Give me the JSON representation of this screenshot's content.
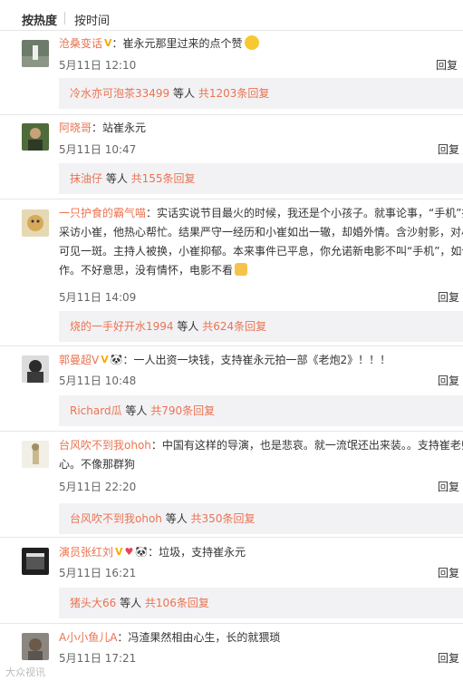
{
  "tabs": {
    "hot": "按热度",
    "time": "按时间"
  },
  "comments": [
    {
      "user": "沧桑变话",
      "badges": [
        "V"
      ],
      "text": "：崔永元那里过来的点个赞",
      "emoji": "grin-emoji",
      "time": "5月11日 12:10",
      "reply": "回复",
      "sub": {
        "name": "冷水亦可泡茶33499",
        "mid": " 等人 ",
        "count": "共1203条回复"
      }
    },
    {
      "user": "阿晓哥",
      "badges": [],
      "text": "：站崔永元",
      "time": "5月11日 10:47",
      "reply": "回复",
      "sub": {
        "name": "抹油仔",
        "mid": " 等人 ",
        "count": "共155条回复"
      }
    },
    {
      "user": "一只护食的霸气喵",
      "badges": [],
      "text": "：实话实说节目最火的时候，我还是个小孩子。就事论事，“手机”拍摄时，",
      "line2": "采访小崔，他热心帮忙。结果严守一经历和小崔如出一辙，却婚外情。含沙射影，对小崔",
      "line3": "可见一斑。主持人被换，小崔抑郁。本来事件已平息，你允诺新电影不叫“手机”，如今又",
      "line4": "作。不好意思，没有情怀，电影不看",
      "time": "5月11日 14:09",
      "reply": "回复",
      "sub": {
        "name": "烧的一手好开水1994",
        "mid": " 等人 ",
        "count": "共624条回复"
      }
    },
    {
      "user": "郭曼超V",
      "badges": [
        "V",
        "panda"
      ],
      "text": "：一人出资一块钱，支持崔永元拍一部《老炮2》！！！",
      "time": "5月11日 10:48",
      "reply": "回复",
      "sub": {
        "name": "Richard瓜",
        "mid": " 等人 ",
        "count": "共790条回复"
      }
    },
    {
      "user": "台风吹不到我ohoh",
      "badges": [],
      "text": "：中国有这样的导演，也是悲哀。就一流氓还出来装。。支持崔老师，良",
      "line2": "心。不像那群狗",
      "time": "5月11日 22:20",
      "reply": "回复",
      "sub": {
        "name": "台风吹不到我ohoh",
        "mid": " 等人 ",
        "count": "共350条回复"
      }
    },
    {
      "user": "演员张红刘",
      "badges": [
        "V",
        "heart",
        "panda"
      ],
      "text": "：垃圾，支持崔永元",
      "time": "5月11日 16:21",
      "reply": "回复",
      "sub": {
        "name": "猪头大66",
        "mid": " 等人 ",
        "count": "共106条回复"
      }
    },
    {
      "user": "A小小鱼儿A",
      "badges": [],
      "text": "：冯渣果然相由心生，长的就猥琐",
      "time": "5月11日 17:21",
      "reply": "回复"
    }
  ],
  "badge_glyphs": {
    "V": "V",
    "panda": "🐼",
    "heart": "♥"
  },
  "watermark": "大众视讯"
}
